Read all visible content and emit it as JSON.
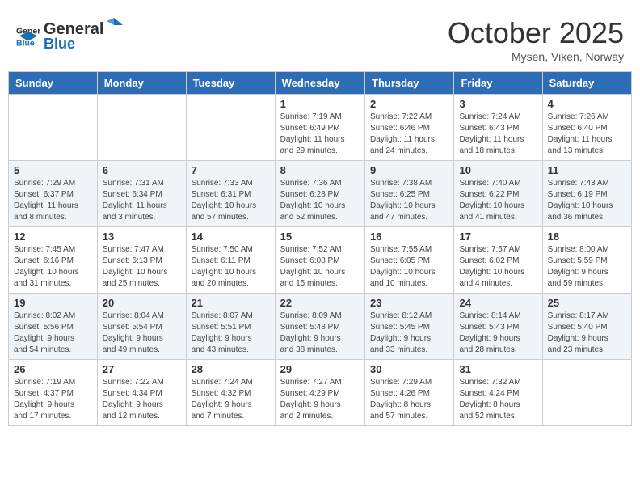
{
  "logo": {
    "general": "General",
    "blue": "Blue"
  },
  "title": "October 2025",
  "subtitle": "Mysen, Viken, Norway",
  "days": [
    "Sunday",
    "Monday",
    "Tuesday",
    "Wednesday",
    "Thursday",
    "Friday",
    "Saturday"
  ],
  "weeks": [
    {
      "shaded": false,
      "days": [
        {
          "num": "",
          "info": ""
        },
        {
          "num": "",
          "info": ""
        },
        {
          "num": "",
          "info": ""
        },
        {
          "num": "1",
          "info": "Sunrise: 7:19 AM\nSunset: 6:49 PM\nDaylight: 11 hours\nand 29 minutes."
        },
        {
          "num": "2",
          "info": "Sunrise: 7:22 AM\nSunset: 6:46 PM\nDaylight: 11 hours\nand 24 minutes."
        },
        {
          "num": "3",
          "info": "Sunrise: 7:24 AM\nSunset: 6:43 PM\nDaylight: 11 hours\nand 18 minutes."
        },
        {
          "num": "4",
          "info": "Sunrise: 7:26 AM\nSunset: 6:40 PM\nDaylight: 11 hours\nand 13 minutes."
        }
      ]
    },
    {
      "shaded": true,
      "days": [
        {
          "num": "5",
          "info": "Sunrise: 7:29 AM\nSunset: 6:37 PM\nDaylight: 11 hours\nand 8 minutes."
        },
        {
          "num": "6",
          "info": "Sunrise: 7:31 AM\nSunset: 6:34 PM\nDaylight: 11 hours\nand 3 minutes."
        },
        {
          "num": "7",
          "info": "Sunrise: 7:33 AM\nSunset: 6:31 PM\nDaylight: 10 hours\nand 57 minutes."
        },
        {
          "num": "8",
          "info": "Sunrise: 7:36 AM\nSunset: 6:28 PM\nDaylight: 10 hours\nand 52 minutes."
        },
        {
          "num": "9",
          "info": "Sunrise: 7:38 AM\nSunset: 6:25 PM\nDaylight: 10 hours\nand 47 minutes."
        },
        {
          "num": "10",
          "info": "Sunrise: 7:40 AM\nSunset: 6:22 PM\nDaylight: 10 hours\nand 41 minutes."
        },
        {
          "num": "11",
          "info": "Sunrise: 7:43 AM\nSunset: 6:19 PM\nDaylight: 10 hours\nand 36 minutes."
        }
      ]
    },
    {
      "shaded": false,
      "days": [
        {
          "num": "12",
          "info": "Sunrise: 7:45 AM\nSunset: 6:16 PM\nDaylight: 10 hours\nand 31 minutes."
        },
        {
          "num": "13",
          "info": "Sunrise: 7:47 AM\nSunset: 6:13 PM\nDaylight: 10 hours\nand 25 minutes."
        },
        {
          "num": "14",
          "info": "Sunrise: 7:50 AM\nSunset: 6:11 PM\nDaylight: 10 hours\nand 20 minutes."
        },
        {
          "num": "15",
          "info": "Sunrise: 7:52 AM\nSunset: 6:08 PM\nDaylight: 10 hours\nand 15 minutes."
        },
        {
          "num": "16",
          "info": "Sunrise: 7:55 AM\nSunset: 6:05 PM\nDaylight: 10 hours\nand 10 minutes."
        },
        {
          "num": "17",
          "info": "Sunrise: 7:57 AM\nSunset: 6:02 PM\nDaylight: 10 hours\nand 4 minutes."
        },
        {
          "num": "18",
          "info": "Sunrise: 8:00 AM\nSunset: 5:59 PM\nDaylight: 9 hours\nand 59 minutes."
        }
      ]
    },
    {
      "shaded": true,
      "days": [
        {
          "num": "19",
          "info": "Sunrise: 8:02 AM\nSunset: 5:56 PM\nDaylight: 9 hours\nand 54 minutes."
        },
        {
          "num": "20",
          "info": "Sunrise: 8:04 AM\nSunset: 5:54 PM\nDaylight: 9 hours\nand 49 minutes."
        },
        {
          "num": "21",
          "info": "Sunrise: 8:07 AM\nSunset: 5:51 PM\nDaylight: 9 hours\nand 43 minutes."
        },
        {
          "num": "22",
          "info": "Sunrise: 8:09 AM\nSunset: 5:48 PM\nDaylight: 9 hours\nand 38 minutes."
        },
        {
          "num": "23",
          "info": "Sunrise: 8:12 AM\nSunset: 5:45 PM\nDaylight: 9 hours\nand 33 minutes."
        },
        {
          "num": "24",
          "info": "Sunrise: 8:14 AM\nSunset: 5:43 PM\nDaylight: 9 hours\nand 28 minutes."
        },
        {
          "num": "25",
          "info": "Sunrise: 8:17 AM\nSunset: 5:40 PM\nDaylight: 9 hours\nand 23 minutes."
        }
      ]
    },
    {
      "shaded": false,
      "days": [
        {
          "num": "26",
          "info": "Sunrise: 7:19 AM\nSunset: 4:37 PM\nDaylight: 9 hours\nand 17 minutes."
        },
        {
          "num": "27",
          "info": "Sunrise: 7:22 AM\nSunset: 4:34 PM\nDaylight: 9 hours\nand 12 minutes."
        },
        {
          "num": "28",
          "info": "Sunrise: 7:24 AM\nSunset: 4:32 PM\nDaylight: 9 hours\nand 7 minutes."
        },
        {
          "num": "29",
          "info": "Sunrise: 7:27 AM\nSunset: 4:29 PM\nDaylight: 9 hours\nand 2 minutes."
        },
        {
          "num": "30",
          "info": "Sunrise: 7:29 AM\nSunset: 4:26 PM\nDaylight: 8 hours\nand 57 minutes."
        },
        {
          "num": "31",
          "info": "Sunrise: 7:32 AM\nSunset: 4:24 PM\nDaylight: 8 hours\nand 52 minutes."
        },
        {
          "num": "",
          "info": ""
        }
      ]
    }
  ]
}
